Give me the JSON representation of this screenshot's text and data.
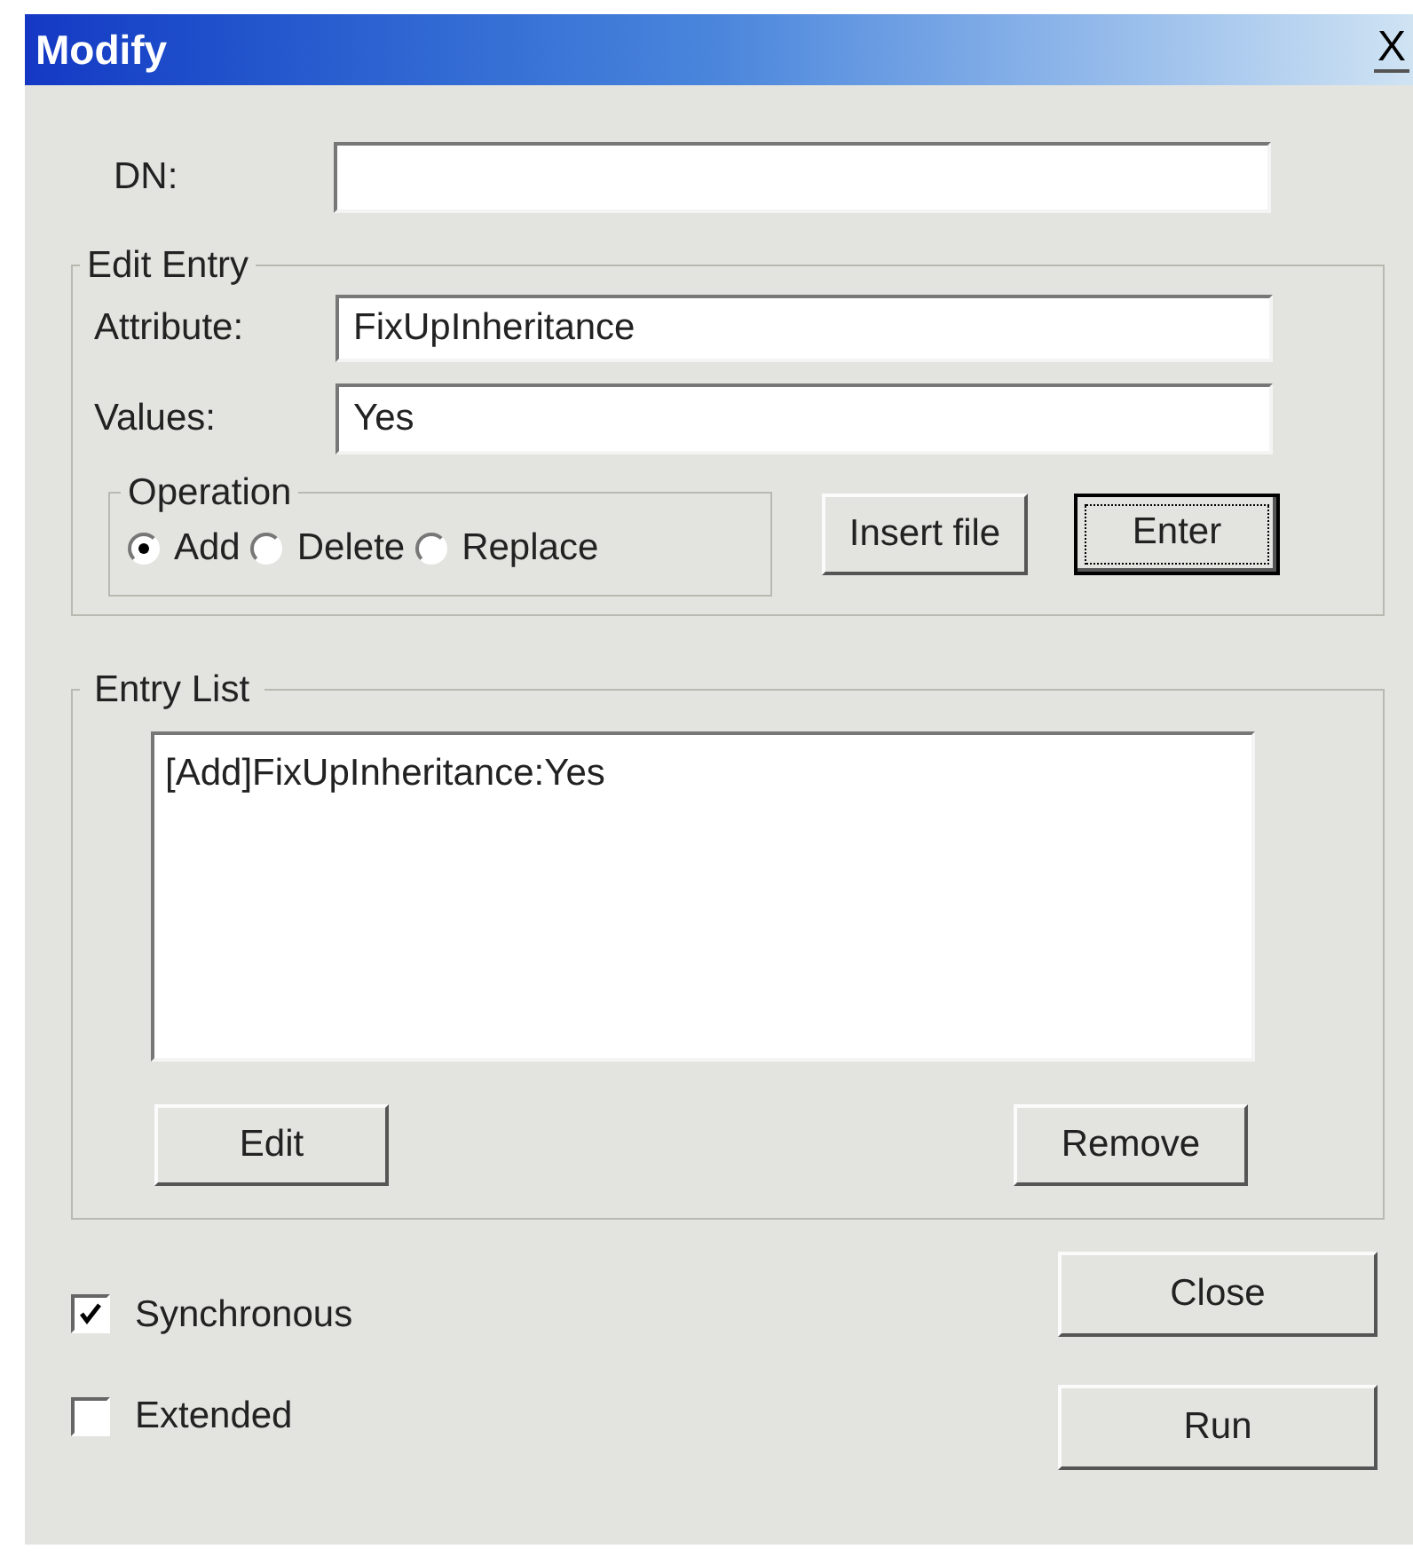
{
  "window": {
    "title": "Modify",
    "close": "X"
  },
  "dn": {
    "label": "DN:"
  },
  "edit_entry": {
    "title": "Edit Entry",
    "attribute": {
      "label": "Attribute:",
      "value": "FixUpInheritance"
    },
    "values": {
      "label": "Values:",
      "value": "Yes"
    },
    "operation": {
      "title": "Operation",
      "options": [
        {
          "label": "Add",
          "selected": true
        },
        {
          "label": "Delete",
          "selected": false
        },
        {
          "label": "Replace",
          "selected": false
        }
      ]
    },
    "buttons": [
      {
        "label": "Insert file",
        "focused": false
      },
      {
        "label": "Enter",
        "focused": true
      }
    ]
  },
  "entry_list": {
    "title": "Entry List",
    "items": [
      {
        "text": "[Add]FixUpInheritance:Yes"
      }
    ],
    "buttons": [
      "Edit",
      "Remove"
    ]
  },
  "options": [
    {
      "label": "Synchronous",
      "checked": true
    },
    {
      "label": "Extended",
      "checked": false
    }
  ],
  "buttons": [
    "Close",
    "Run"
  ]
}
